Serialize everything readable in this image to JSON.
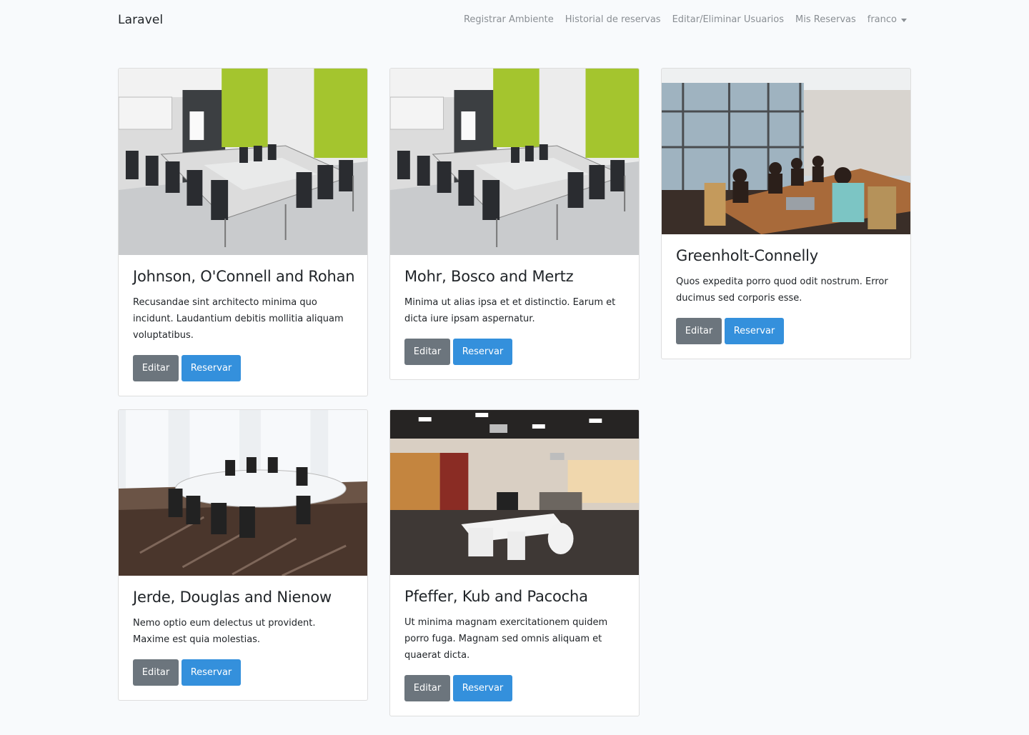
{
  "navbar": {
    "brand": "Laravel",
    "links": [
      "Registrar Ambiente",
      "Historial de reservas",
      "Editar/Eliminar Usuarios",
      "Mis Reservas"
    ],
    "user": "franco"
  },
  "cards": [
    {
      "title": "Johnson, O'Connell and Rohan",
      "text": "Recusandae sint architecto minima quo incidunt. Laudantium debitis mollitia aliquam voluptatibus.",
      "edit_label": "Editar",
      "reserve_label": "Reservar",
      "image": "conference-room-green-wall"
    },
    {
      "title": "Mohr, Bosco and Mertz",
      "text": "Minima ut alias ipsa et et distinctio. Earum et dicta iure ipsam aspernatur.",
      "edit_label": "Editar",
      "reserve_label": "Reservar",
      "image": "conference-room-green-wall"
    },
    {
      "title": "Greenholt-Connelly",
      "text": "Quos expedita porro quod odit nostrum. Error ducimus sed corporis esse.",
      "edit_label": "Editar",
      "reserve_label": "Reservar",
      "image": "meeting-with-people"
    },
    {
      "title": "Jerde, Douglas and Nienow",
      "text": "Nemo optio eum delectus ut provident. Maxime est quia molestias.",
      "edit_label": "Editar",
      "reserve_label": "Reservar",
      "image": "white-oval-table-room"
    },
    {
      "title": "Pfeffer, Kub and Pacocha",
      "text": "Ut minima magnam exercitationem quidem porro fuga. Magnam sed omnis aliquam et quaerat dicta.",
      "edit_label": "Editar",
      "reserve_label": "Reservar",
      "image": "open-plan-office"
    }
  ]
}
